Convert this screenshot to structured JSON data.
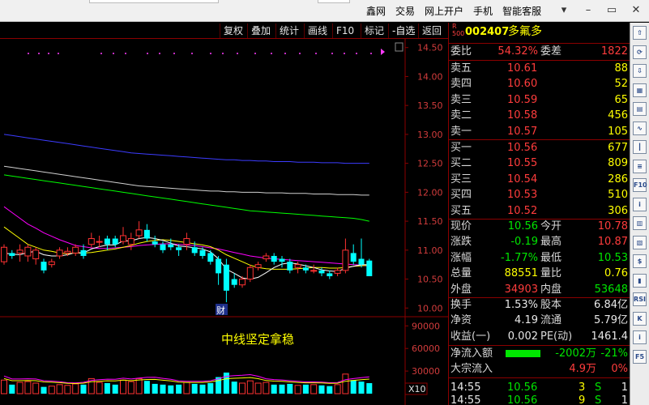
{
  "menu": {
    "items": [
      "鑫网",
      "交易",
      "网上开户",
      "手机",
      "智能客服"
    ],
    "icons": [
      "down-arrow-icon",
      "minimize-icon",
      "restore-icon",
      "close-icon"
    ]
  },
  "toolbar": {
    "buttons": [
      "复权",
      "叠加",
      "统计",
      "画线",
      "F10",
      "标记",
      "-自选",
      "返回"
    ]
  },
  "chart": {
    "price_ticks": [
      "14.50",
      "14.00",
      "13.50",
      "13.00",
      "12.50",
      "12.00",
      "11.50",
      "11.00",
      "10.50",
      "10.00"
    ],
    "volume_ticks": [
      "90000",
      "60000",
      "30000"
    ],
    "volume_unit": "X10",
    "event_marker": "财",
    "annotation": "中线坚定拿稳",
    "colors": {
      "up": "#ff3232",
      "down": "#00ffff",
      "ma5": "#ffffff",
      "ma10": "#ffff00",
      "ma20": "#ff00ff",
      "ma60": "#00ff00",
      "ma120": "#d0d0d0",
      "ma250": "#3c3cff",
      "grid": "#8b0000"
    }
  },
  "chart_data": {
    "type": "line",
    "candles": [
      [
        10.8,
        11.05,
        11.1,
        10.75
      ],
      [
        10.95,
        10.9,
        11.0,
        10.85
      ],
      [
        10.95,
        11.0,
        11.1,
        10.8
      ],
      [
        10.9,
        11.05,
        11.1,
        10.8
      ],
      [
        10.85,
        11.0,
        11.05,
        10.75
      ],
      [
        10.8,
        10.65,
        10.85,
        10.6
      ],
      [
        10.75,
        10.8,
        10.85,
        10.7
      ],
      [
        10.9,
        11.0,
        11.05,
        10.85
      ],
      [
        10.95,
        10.98,
        11.05,
        10.9
      ],
      [
        10.95,
        11.05,
        11.1,
        10.9
      ],
      [
        11.0,
        10.9,
        11.1,
        10.85
      ],
      [
        11.1,
        11.2,
        11.3,
        11.05
      ],
      [
        11.15,
        11.15,
        11.25,
        11.05
      ],
      [
        11.2,
        11.1,
        11.25,
        11.0
      ],
      [
        11.2,
        11.1,
        11.25,
        11.05
      ],
      [
        11.15,
        11.25,
        11.4,
        11.1
      ],
      [
        11.1,
        11.2,
        11.3,
        11.0
      ],
      [
        11.25,
        11.35,
        11.5,
        11.2
      ],
      [
        11.35,
        11.2,
        11.45,
        11.15
      ],
      [
        11.15,
        11.1,
        11.25,
        11.05
      ],
      [
        11.1,
        11.0,
        11.15,
        10.95
      ],
      [
        11.1,
        11.05,
        11.2,
        11.0
      ],
      [
        11.05,
        11.0,
        11.1,
        10.9
      ],
      [
        11.1,
        11.2,
        11.3,
        11.0
      ],
      [
        11.05,
        10.95,
        11.15,
        10.9
      ],
      [
        11.0,
        10.9,
        11.05,
        10.85
      ],
      [
        10.95,
        10.8,
        11.0,
        10.75
      ],
      [
        10.85,
        10.6,
        10.9,
        10.4
      ],
      [
        10.75,
        10.3,
        10.85,
        10.1
      ],
      [
        10.5,
        10.4,
        10.6,
        10.35
      ],
      [
        10.4,
        10.5,
        10.55,
        10.35
      ],
      [
        10.5,
        10.7,
        10.75,
        10.45
      ],
      [
        10.7,
        10.75,
        10.8,
        10.65
      ],
      [
        10.85,
        10.9,
        10.95,
        10.8
      ],
      [
        10.9,
        10.8,
        10.95,
        10.75
      ],
      [
        10.85,
        10.8,
        10.9,
        10.7
      ],
      [
        10.8,
        10.65,
        10.85,
        10.6
      ],
      [
        10.7,
        10.75,
        10.8,
        10.6
      ],
      [
        10.7,
        10.65,
        10.75,
        10.6
      ],
      [
        10.65,
        10.65,
        10.75,
        10.6
      ],
      [
        10.65,
        10.6,
        10.7,
        10.55
      ],
      [
        10.6,
        10.55,
        10.65,
        10.5
      ],
      [
        10.6,
        10.65,
        10.7,
        10.55
      ],
      [
        10.65,
        11.0,
        11.2,
        10.6
      ],
      [
        10.95,
        10.8,
        11.1,
        10.75
      ],
      [
        10.85,
        10.75,
        11.2,
        10.7
      ],
      [
        10.82,
        10.55,
        10.85,
        10.55
      ]
    ],
    "volume": [
      18000,
      12000,
      15000,
      16000,
      14000,
      9000,
      10000,
      12000,
      11000,
      13000,
      12000,
      20000,
      15000,
      14000,
      12000,
      18000,
      16000,
      20000,
      17000,
      13000,
      12000,
      11000,
      12000,
      15000,
      13000,
      12000,
      14000,
      22000,
      28000,
      16000,
      14000,
      17000,
      14000,
      15000,
      12000,
      12000,
      13000,
      11000,
      12000,
      12000,
      11000,
      10000,
      12000,
      26000,
      18000,
      16000,
      14000
    ],
    "ma": {
      "ma5": [
        10.95,
        10.93,
        10.92,
        10.96,
        10.98,
        10.92,
        10.9,
        10.9,
        10.92,
        10.96,
        10.95,
        11.02,
        11.06,
        11.09,
        11.09,
        11.16,
        11.16,
        11.2,
        11.22,
        11.2,
        11.17,
        11.12,
        11.07,
        11.06,
        11.04,
        11.02,
        10.97,
        10.85,
        10.67,
        10.6,
        10.52,
        10.5,
        10.53,
        10.61,
        10.7,
        10.76,
        10.78,
        10.76,
        10.73,
        10.7,
        10.66,
        10.64,
        10.63,
        10.69,
        10.72,
        10.75,
        10.75
      ],
      "ma10": [
        11.4,
        11.3,
        11.2,
        11.1,
        11.05,
        11.0,
        10.98,
        10.95,
        10.94,
        10.95,
        10.95,
        10.96,
        10.98,
        11.0,
        11.02,
        11.05,
        11.08,
        11.12,
        11.15,
        11.17,
        11.18,
        11.17,
        11.15,
        11.13,
        11.11,
        11.09,
        11.06,
        11.0,
        10.92,
        10.86,
        10.8,
        10.74,
        10.7,
        10.68,
        10.67,
        10.67,
        10.67,
        10.68,
        10.69,
        10.7,
        10.7,
        10.69,
        10.69,
        10.7,
        10.72,
        10.73,
        10.74
      ],
      "ma20": [
        11.75,
        11.65,
        11.55,
        11.45,
        11.38,
        11.3,
        11.24,
        11.18,
        11.13,
        11.08,
        11.06,
        11.04,
        11.03,
        11.03,
        11.04,
        11.05,
        11.06,
        11.08,
        11.09,
        11.1,
        11.11,
        11.11,
        11.1,
        11.09,
        11.08,
        11.06,
        11.04,
        11.02,
        10.99,
        10.96,
        10.93,
        10.9,
        10.88,
        10.86,
        10.85,
        10.84,
        10.83,
        10.82,
        10.81,
        10.8,
        10.79,
        10.78,
        10.77,
        10.76,
        10.75,
        10.74,
        10.72
      ],
      "ma60": [
        12.3,
        12.28,
        12.26,
        12.24,
        12.22,
        12.2,
        12.18,
        12.16,
        12.14,
        12.12,
        12.1,
        12.08,
        12.06,
        12.04,
        12.02,
        12.0,
        11.98,
        11.96,
        11.94,
        11.92,
        11.9,
        11.88,
        11.86,
        11.84,
        11.82,
        11.8,
        11.78,
        11.76,
        11.74,
        11.72,
        11.7,
        11.68,
        11.67,
        11.66,
        11.65,
        11.64,
        11.63,
        11.62,
        11.61,
        11.6,
        11.59,
        11.58,
        11.57,
        11.56,
        11.55,
        11.53,
        11.5
      ],
      "ma120": [
        12.45,
        12.43,
        12.41,
        12.39,
        12.37,
        12.35,
        12.33,
        12.31,
        12.29,
        12.27,
        12.25,
        12.23,
        12.21,
        12.19,
        12.17,
        12.15,
        12.13,
        12.11,
        12.1,
        12.09,
        12.08,
        12.07,
        12.06,
        12.05,
        12.04,
        12.03,
        12.02,
        12.02,
        12.01,
        12.01,
        12.0,
        12.0,
        12.0,
        11.99,
        11.99,
        11.99,
        11.98,
        11.98,
        11.98,
        11.97,
        11.97,
        11.97,
        11.96,
        11.96,
        11.96,
        11.95,
        11.95
      ],
      "ma250": [
        13.0,
        12.98,
        12.96,
        12.94,
        12.92,
        12.9,
        12.88,
        12.86,
        12.84,
        12.82,
        12.8,
        12.78,
        12.76,
        12.74,
        12.72,
        12.7,
        12.68,
        12.67,
        12.66,
        12.65,
        12.64,
        12.63,
        12.62,
        12.61,
        12.6,
        12.59,
        12.58,
        12.57,
        12.56,
        12.56,
        12.55,
        12.55,
        12.54,
        12.54,
        12.53,
        12.53,
        12.53,
        12.52,
        12.52,
        12.52,
        12.51,
        12.51,
        12.51,
        12.5,
        12.5,
        12.5,
        12.5
      ]
    },
    "ylim": [
      9.85,
      14.65
    ],
    "volume_ylim": [
      0,
      100000
    ]
  },
  "quote": {
    "badge": "R 500",
    "code": "002407",
    "name": "多氟多",
    "weibi_label": "委比",
    "weibi": "54.32%",
    "weicha_label": "委差",
    "weicha": "1822",
    "sells": [
      {
        "label": "卖五",
        "price": "10.61",
        "vol": "88"
      },
      {
        "label": "卖四",
        "price": "10.60",
        "vol": "52"
      },
      {
        "label": "卖三",
        "price": "10.59",
        "vol": "65"
      },
      {
        "label": "卖二",
        "price": "10.58",
        "vol": "456"
      },
      {
        "label": "卖一",
        "price": "10.57",
        "vol": "105"
      }
    ],
    "buys": [
      {
        "label": "买一",
        "price": "10.56",
        "vol": "677"
      },
      {
        "label": "买二",
        "price": "10.55",
        "vol": "809"
      },
      {
        "label": "买三",
        "price": "10.54",
        "vol": "286"
      },
      {
        "label": "买四",
        "price": "10.53",
        "vol": "510"
      },
      {
        "label": "买五",
        "price": "10.52",
        "vol": "306"
      }
    ],
    "stats": [
      {
        "l1": "现价",
        "v1": "10.56",
        "c1": "grn",
        "l2": "今开",
        "v2": "10.78",
        "c2": "red"
      },
      {
        "l1": "涨跌",
        "v1": "-0.19",
        "c1": "grn",
        "l2": "最高",
        "v2": "10.87",
        "c2": "red"
      },
      {
        "l1": "涨幅",
        "v1": "-1.77%",
        "c1": "grn",
        "l2": "最低",
        "v2": "10.53",
        "c2": "grn"
      },
      {
        "l1": "总量",
        "v1": "88551",
        "c1": "yel",
        "l2": "量比",
        "v2": "0.76",
        "c2": "yel"
      },
      {
        "l1": "外盘",
        "v1": "34903",
        "c1": "red",
        "l2": "内盘",
        "v2": "53648",
        "c2": "grn"
      }
    ],
    "fund": [
      {
        "l1": "换手",
        "v1": "1.53%",
        "l2": "股本",
        "v2": "6.84亿"
      },
      {
        "l1": "净资",
        "v1": "4.19",
        "l2": "流通",
        "v2": "5.79亿"
      },
      {
        "l1": "收益(一)",
        "v1": "0.002",
        "l2": "PE(动)",
        "v2": "1461.4"
      }
    ],
    "flow": [
      {
        "label": "净流入额",
        "bar": 0.6,
        "value": "-2002万",
        "pct": "-21%"
      },
      {
        "label": "大宗流入",
        "value": "4.9万",
        "pct": "0%"
      }
    ],
    "ticks": [
      {
        "time": "14:55",
        "price": "10.56",
        "vol": "3",
        "side": "S",
        "num": "1"
      },
      {
        "time": "14:55",
        "price": "10.56",
        "vol": "9",
        "side": "S",
        "num": "1"
      }
    ]
  },
  "strip_icons": [
    "up-arrow-icon",
    "refresh-icon",
    "down-arrow-icon",
    "grid-icon",
    "chart-icon",
    "line-chart-icon",
    "candle-icon",
    "list-icon",
    "f10-icon",
    "info-icon",
    "index-icon",
    "rank-icon",
    "money-icon",
    "bar-icon",
    "rsi-icon",
    "k-icon",
    "info2-icon",
    "f5-icon"
  ]
}
